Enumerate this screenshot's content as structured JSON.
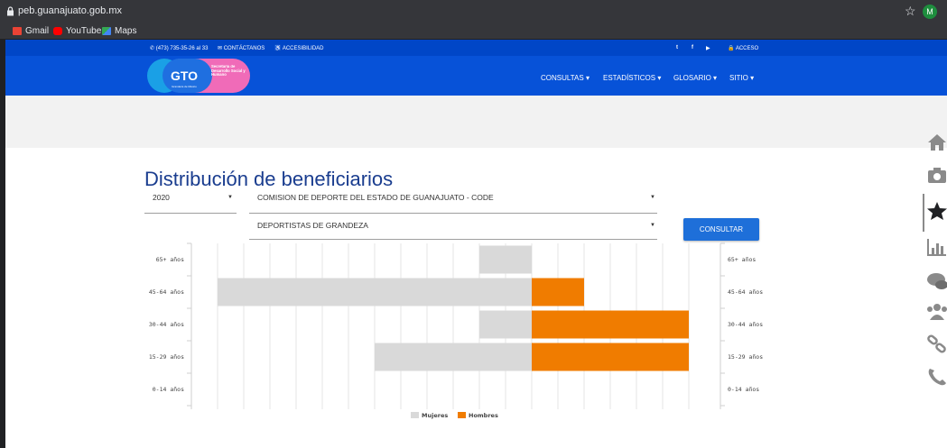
{
  "browser": {
    "url": "peb.guanajuato.gob.mx",
    "avatar_letter": "M",
    "bookmarks": [
      {
        "label": "Gmail",
        "icon": "gmail-icon",
        "color": "#ea4335"
      },
      {
        "label": "YouTube",
        "icon": "youtube-icon",
        "color": "#ff0000"
      },
      {
        "label": "Maps",
        "icon": "maps-icon",
        "color": "#34a853"
      }
    ]
  },
  "topbar": {
    "phone": "(473) 735-35-26 al 33",
    "contact": "CONTÁCTANOS",
    "accessibility": "ACCESIBILIDAD",
    "login": "ACCESO"
  },
  "logo": {
    "mark": "GTO",
    "tagline": "Grandeza de México",
    "dept": "Secretaría de Desarrollo Social y Humano"
  },
  "nav": {
    "items": [
      "CONSULTAS",
      "ESTADÍSTICOS",
      "GLOSARIO",
      "SITIO"
    ]
  },
  "page": {
    "title": "Distribución de beneficiarios",
    "year": "2020",
    "agency": "COMISION DE DEPORTE DEL ESTADO DE GUANAJUATO - CODE",
    "program": "DEPORTISTAS DE GRANDEZA",
    "button": "CONSULTAR"
  },
  "colors": {
    "mujeres": "#d9d9d9",
    "hombres": "#f07c00",
    "brand_blue": "#0752d8"
  },
  "chart_data": {
    "type": "bar",
    "orientation": "horizontal-pyramid",
    "categories": [
      "65+ años",
      "45-64 años",
      "30-44 años",
      "15-29 años",
      "0-14 años"
    ],
    "series": [
      {
        "name": "Mujeres",
        "values": [
          1,
          6,
          1,
          3,
          0
        ]
      },
      {
        "name": "Hombres",
        "values": [
          0,
          1,
          3,
          3,
          0
        ]
      }
    ],
    "xlim": [
      -6,
      3
    ],
    "legend": "bottom",
    "grid": true
  },
  "sidebar": {
    "icons": [
      "home-icon",
      "camera-icon",
      "star-icon",
      "bar-chart-icon",
      "comments-icon",
      "users-icon",
      "link-icon",
      "phone-icon"
    ]
  }
}
